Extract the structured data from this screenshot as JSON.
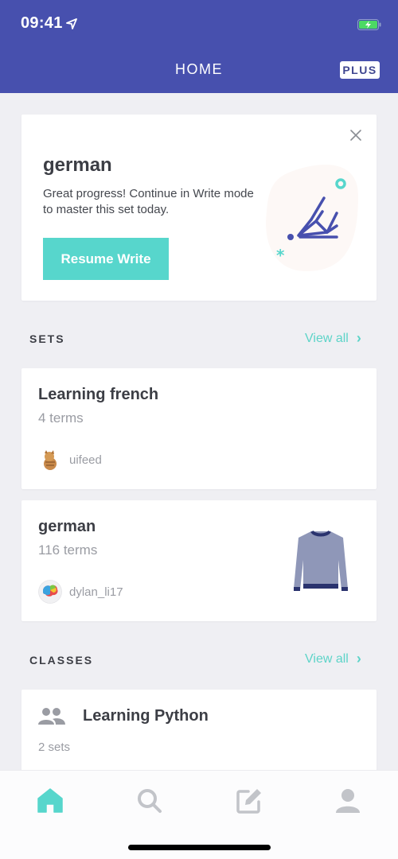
{
  "status_bar": {
    "time": "09:41"
  },
  "header": {
    "title": "HOME",
    "plus_badge": "PLUS"
  },
  "colors": {
    "brand": "#4750ae",
    "accent": "#57d6cc",
    "muted_icon": "#c2c4c9"
  },
  "promo": {
    "title": "german",
    "message": "Great progress! Continue in Write mode to master this set today.",
    "button_label": "Resume Write"
  },
  "sets_section": {
    "header": "SETS",
    "view_all": "View all",
    "items": [
      {
        "title": "Learning french",
        "terms": "4 terms",
        "author": "uifeed"
      },
      {
        "title": "german",
        "terms": "116 terms",
        "author": "dylan_li17"
      }
    ]
  },
  "classes_section": {
    "header": "CLASSES",
    "view_all": "View all",
    "items": [
      {
        "title": "Learning Python",
        "sets": "2 sets"
      }
    ]
  },
  "tab_bar": {
    "items": [
      {
        "icon": "home-icon",
        "active": true
      },
      {
        "icon": "search-icon",
        "active": false
      },
      {
        "icon": "create-icon",
        "active": false
      },
      {
        "icon": "profile-icon",
        "active": false
      }
    ]
  }
}
